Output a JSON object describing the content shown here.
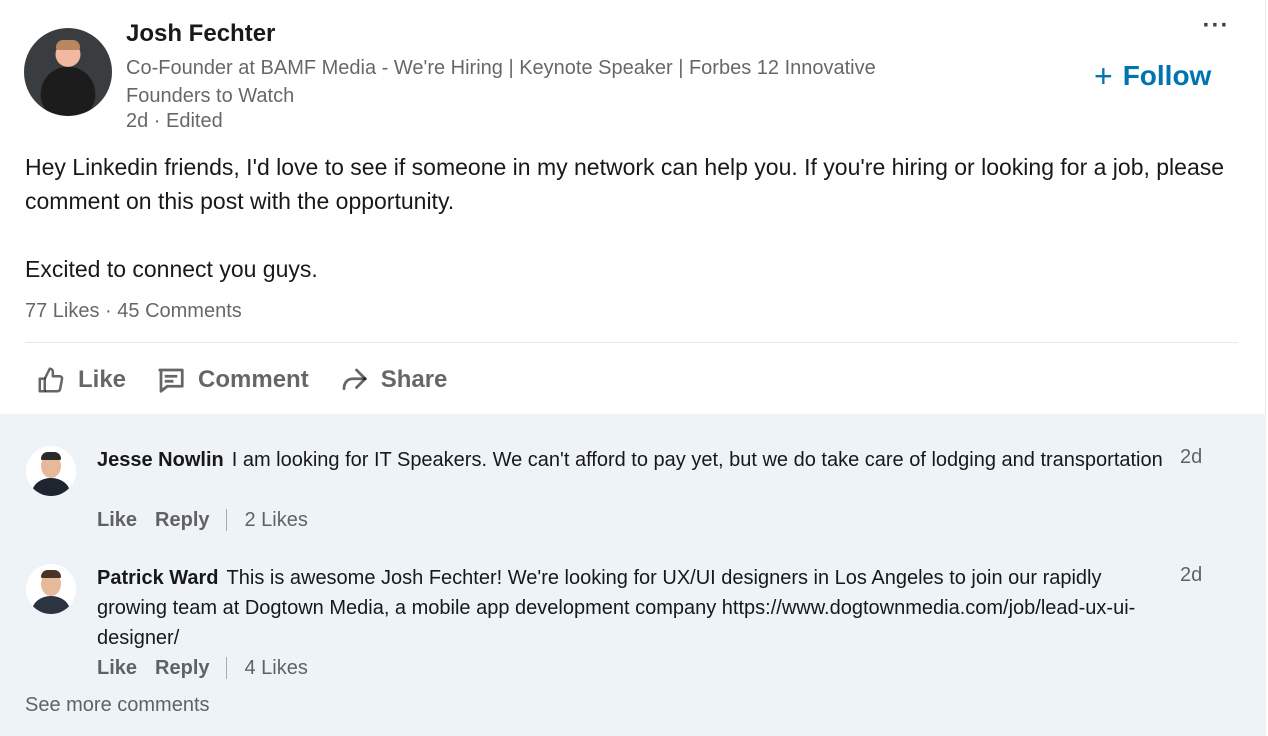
{
  "post": {
    "author": "Josh Fechter",
    "headline": "Co-Founder at BAMF Media - We're Hiring | Keynote Speaker | Forbes 12 Innovative Founders to Watch",
    "timestamp": "2d · Edited",
    "follow_label": "Follow",
    "more_label": "···",
    "paragraph_1": "Hey Linkedin friends, I'd love to see if someone in my network can help you. If you're hiring or looking for a job, please comment on this post with the opportunity.",
    "paragraph_2": "Excited to connect you guys.",
    "likes": "77 Likes",
    "dot": " · ",
    "comments_count": "45 Comments"
  },
  "actions": {
    "like": "Like",
    "comment": "Comment",
    "share": "Share"
  },
  "comments": [
    {
      "name": "Jesse Nowlin",
      "text": "I am looking for IT Speakers. We can't afford to pay yet, but we do take care of lodging and transportation",
      "time": "2d",
      "like": "Like",
      "reply": "Reply",
      "likes": "2 Likes"
    },
    {
      "name": "Patrick Ward",
      "text": "This is awesome Josh Fechter! We're looking for UX/UI designers in Los Angeles to join our rapidly growing team at Dogtown Media, a mobile app development company https://www.dogtownmedia.com/job/lead-ux-ui-designer/",
      "time": "2d",
      "like": "Like",
      "reply": "Reply",
      "likes": "4 Likes"
    }
  ],
  "see_more": "See more comments",
  "colors": {
    "accent": "#0073b1",
    "comments_bg": "#eef3f8"
  }
}
